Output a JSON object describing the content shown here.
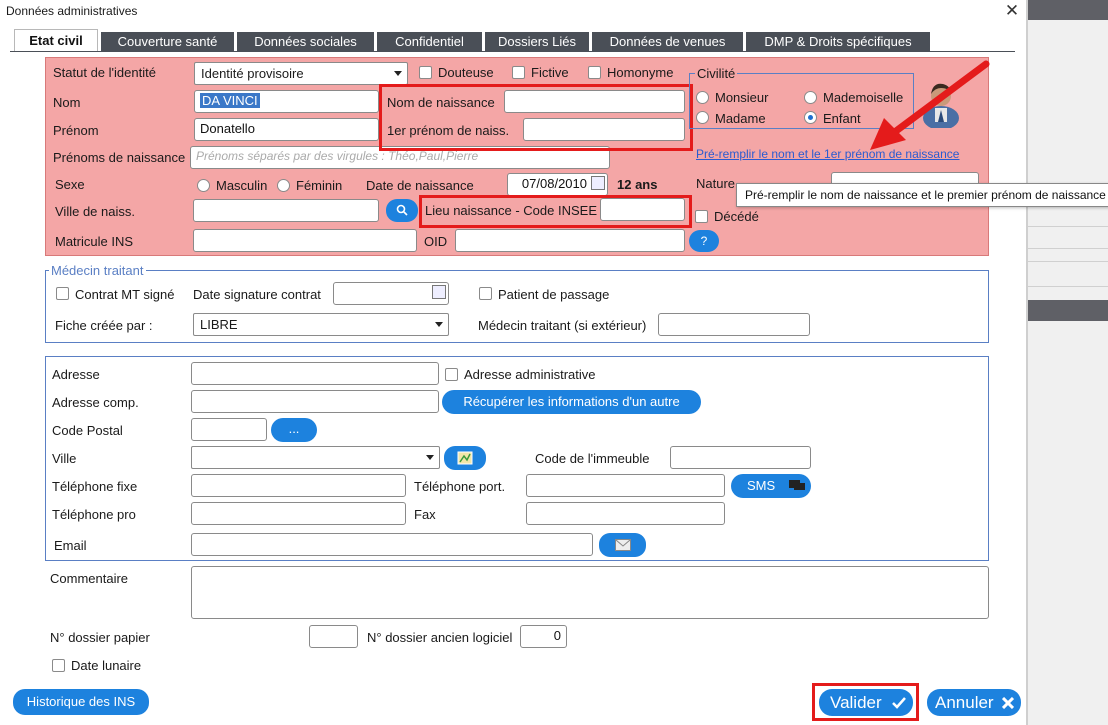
{
  "window": {
    "title": "Données administratives",
    "close_symbol": "✕"
  },
  "tabs": [
    {
      "label": "Etat civil"
    },
    {
      "label": "Couverture santé"
    },
    {
      "label": "Données sociales"
    },
    {
      "label": "Confidentiel"
    },
    {
      "label": "Dossiers Liés"
    },
    {
      "label": "Données de venues"
    },
    {
      "label": "DMP & Droits spécifiques"
    }
  ],
  "identity": {
    "statut_label": "Statut de l'identité",
    "statut_value": "Identité provisoire",
    "douteuse": "Douteuse",
    "fictive": "Fictive",
    "homonyme": "Homonyme",
    "nom_label": "Nom",
    "nom_value": "DA VINCI",
    "prenom_label": "Prénom",
    "prenom_value": "Donatello",
    "prenoms_naissance_label": "Prénoms de naissance",
    "prenoms_naissance_placeholder": "Prénoms séparés par des virgules : Théo,Paul,Pierre",
    "nom_naissance_label": "Nom de naissance",
    "premier_prenom_label": "1er prénom de naiss.",
    "sexe_label": "Sexe",
    "masculin": "Masculin",
    "feminin": "Féminin",
    "date_naissance_label": "Date de naissance",
    "date_naissance_value": "07/08/2010",
    "age": "12 ans",
    "ville_naiss_label": "Ville de naiss.",
    "lieu_insee_label": "Lieu naissance - Code INSEE",
    "decede": "Décédé",
    "nature_label": "Nature",
    "matricule_label": "Matricule INS",
    "oid_label": "OID",
    "help": "?",
    "civilite_label": "Civilité",
    "monsieur": "Monsieur",
    "mademoiselle": "Mademoiselle",
    "madame": "Madame",
    "enfant": "Enfant",
    "prefill_link": "Pré-remplir le nom et le 1er prénom de naissance",
    "prefill_tooltip": "Pré-remplir le nom de naissance et le premier prénom de naissance"
  },
  "medecin": {
    "legend": "Médecin traitant",
    "contrat_mt": "Contrat MT signé",
    "date_signature_label": "Date signature contrat",
    "patient_passage": "Patient de passage",
    "fiche_label": "Fiche créée par :",
    "fiche_value": "LIBRE",
    "medecin_ext_label": "Médecin traitant (si extérieur)"
  },
  "address": {
    "adresse_label": "Adresse",
    "adresse_admin": "Adresse administrative",
    "adresse_comp_label": "Adresse comp.",
    "recuperer_button": "Récupérer les informations d'un autre",
    "code_postal_label": "Code Postal",
    "cp_button": "...",
    "ville_label": "Ville",
    "code_immeuble_label": "Code de l'immeuble",
    "tel_fixe_label": "Téléphone fixe",
    "tel_port_label": "Téléphone port.",
    "sms_button": "SMS",
    "tel_pro_label": "Téléphone pro",
    "fax_label": "Fax",
    "email_label": "Email"
  },
  "misc": {
    "commentaire_label": "Commentaire",
    "dossier_papier_label": "N° dossier papier",
    "dossier_ancien_label": "N° dossier ancien logiciel",
    "dossier_ancien_value": "0",
    "date_lunaire": "Date lunaire"
  },
  "footer": {
    "historique_button": "Historique des INS",
    "valider_button": "Valider",
    "annuler_button": "Annuler"
  },
  "colors": {
    "accent": "#1d82de",
    "identity_panel": "#f4a6a6",
    "highlight_red": "#e41b1b",
    "tab_dark": "#4a4f57"
  }
}
